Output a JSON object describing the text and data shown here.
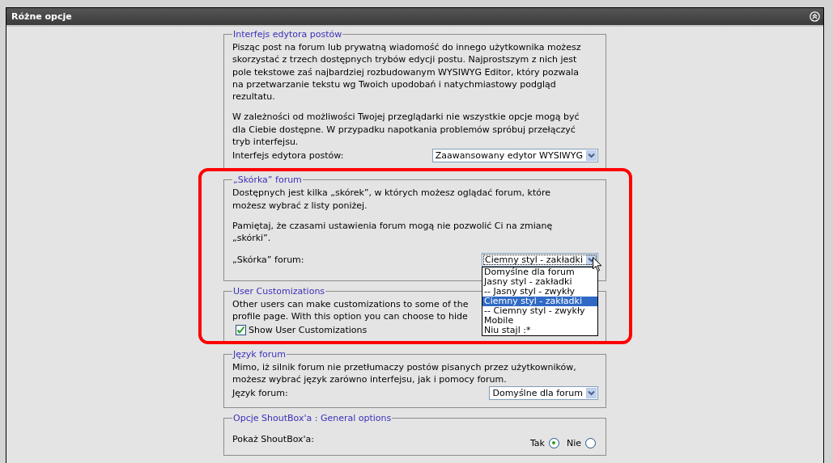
{
  "panel": {
    "title": "Różne opcje"
  },
  "sections": [
    {
      "kind": "select",
      "legend": "Interfejs edytora postów",
      "paragraphs": [
        [
          "Pisząc post na forum lub prywatną wiadomość do innego użytkownika możesz",
          "skorzystać z trzech dostępnych trybów edycji postu. Najprostszym z nich jest",
          "pole tekstowe zaś najbardziej rozbudowanym WYSIWYG Editor, który pozwala",
          "na przetwarzanie tekstu wg Twoich upodobań i natychmiastowy podgląd",
          "rezultatu."
        ],
        [
          "W zależności od możliwości Twojej przeglądarki nie wszystkie opcje mogą być",
          "dla Ciebie dostępne. W przypadku napotkania problemów spróbuj przełączyć",
          "tryb interfejsu."
        ]
      ],
      "label": "Interfejs edytora postów:",
      "select": {
        "value": "Zaawansowany edytor WYSIWYG",
        "open": false
      }
    },
    {
      "kind": "select",
      "legend": "„Skórka” forum",
      "paragraphs": [
        [
          "Dostępnych jest kilka „skórek”, w których możesz oglądać forum, które",
          "możesz wybrać z listy poniżej."
        ],
        [
          "Pamiętaj, że czasami ustawienia forum mogą nie pozwolić Ci na zmianę",
          "„skórki”."
        ]
      ],
      "label": "„Skórka” forum:",
      "select": {
        "value": "Ciemny styl - zakładki",
        "open": true,
        "options": [
          {
            "label": "Domyślne dla forum",
            "selected": false
          },
          {
            "label": "Jasny styl - zakładki",
            "selected": false
          },
          {
            "label": "-- Jasny styl - zwykły",
            "selected": false
          },
          {
            "label": "Ciemny styl - zakładki",
            "selected": true
          },
          {
            "label": "-- Ciemny styl - zwykły",
            "selected": false
          },
          {
            "label": "Mobile",
            "selected": false
          },
          {
            "label": "Niu stajl :*",
            "selected": false
          }
        ]
      }
    },
    {
      "kind": "checkbox",
      "legend": "User Customizations",
      "paragraphs": [
        [
          "Other users can make customizations to some of the",
          "profile page. With this option you can choose to hide"
        ]
      ],
      "checkbox": {
        "label": "Show User Customizations",
        "checked": true
      }
    },
    {
      "kind": "select",
      "legend": "Język forum",
      "paragraphs": [
        [
          "Mimo, iż silnik forum nie przetłumaczy postów pisanych przez użytkowników,",
          "możesz wybrać język zarówno interfejsu, jak i pomocy forum."
        ]
      ],
      "label": "Język forum:",
      "select": {
        "value": "Domyślne dla forum",
        "open": false
      }
    },
    {
      "kind": "radio",
      "legend": "Opcje ShoutBox'a : General options",
      "label": "Pokaż ShoutBox'a:",
      "radios": [
        {
          "label": "Tak",
          "selected": true
        },
        {
          "label": "Nie",
          "selected": false
        }
      ]
    }
  ]
}
